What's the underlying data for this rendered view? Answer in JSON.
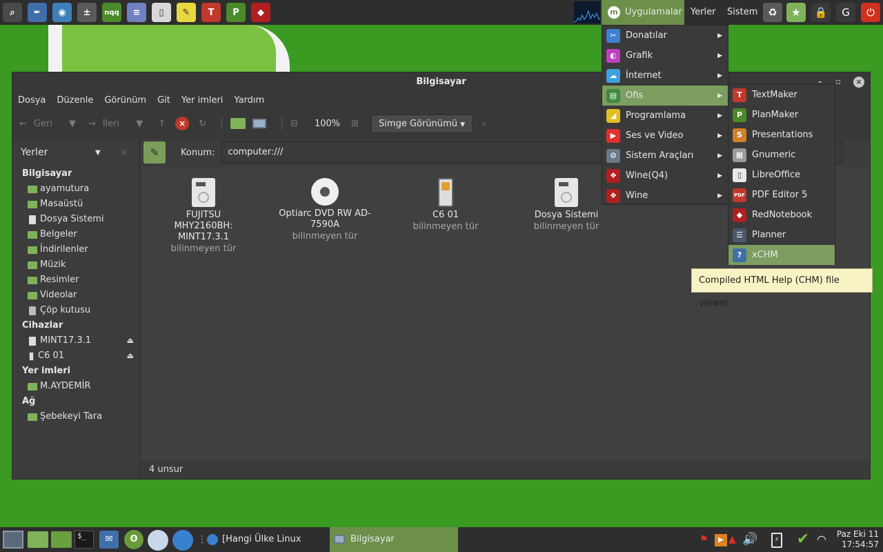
{
  "top_panel": {
    "launchers": [
      {
        "icon": "search-icon",
        "color": "#4a4a4a",
        "glyph": "⌕"
      },
      {
        "icon": "pen-tool-icon",
        "color": "#3f6ea8",
        "glyph": "✒"
      },
      {
        "icon": "camera-icon",
        "color": "#3f7fb8",
        "glyph": "◉"
      },
      {
        "icon": "calculator-icon",
        "color": "#5a5a5a",
        "glyph": "±"
      },
      {
        "icon": "nqq-icon",
        "color": "#4b8a2a",
        "glyph": "nqq"
      },
      {
        "icon": "notes-icon",
        "color": "#7080c0",
        "glyph": "≡"
      },
      {
        "icon": "document-icon",
        "color": "#d8d8d8",
        "glyph": "▯"
      },
      {
        "icon": "sticky-note-icon",
        "color": "#e8d840",
        "glyph": "✎"
      },
      {
        "icon": "textmaker-icon",
        "color": "#c0392b",
        "glyph": "T"
      },
      {
        "icon": "planmaker-icon",
        "color": "#4b8a2a",
        "glyph": "P"
      },
      {
        "icon": "rednotebook-icon",
        "color": "#b02020",
        "glyph": "◆"
      }
    ],
    "apps_label": "Uygulamalar",
    "places_label": "Yerler",
    "system_label": "Sistem",
    "tray": [
      {
        "icon": "trash-icon",
        "color": "#5a5a5a",
        "glyph": "♻"
      },
      {
        "icon": "folder-star-icon",
        "color": "#7fb35a",
        "glyph": "★"
      },
      {
        "icon": "lock-icon",
        "color": "#3a3a3a",
        "glyph": "🔒"
      },
      {
        "icon": "logout-icon",
        "color": "#3a3a3a",
        "glyph": "G"
      },
      {
        "icon": "power-icon",
        "color": "#d03020",
        "glyph": "⏻"
      }
    ]
  },
  "window": {
    "title": "Bilgisayar",
    "menubar": [
      "Dosya",
      "Düzenle",
      "Görünüm",
      "Git",
      "Yer imleri",
      "Yardım"
    ],
    "toolbar": {
      "back_label": "Geri",
      "forward_label": "İleri",
      "zoom": "100%",
      "view_mode": "Simge Görünümü"
    },
    "sidebar": {
      "header": "Yerler",
      "sections": [
        {
          "title": "Bilgisayar",
          "items": [
            {
              "label": "ayamutura",
              "kind": "folder"
            },
            {
              "label": "Masaüstü",
              "kind": "folder"
            },
            {
              "label": "Dosya Sistemi",
              "kind": "drive"
            },
            {
              "label": "Belgeler",
              "kind": "folder"
            },
            {
              "label": "İndirilenler",
              "kind": "folder"
            },
            {
              "label": "Müzik",
              "kind": "folder"
            },
            {
              "label": "Resimler",
              "kind": "folder"
            },
            {
              "label": "Videolar",
              "kind": "folder"
            },
            {
              "label": "Çöp kutusu",
              "kind": "trash"
            }
          ]
        },
        {
          "title": "Cihazlar",
          "items": [
            {
              "label": "MINT17.3.1",
              "kind": "drive",
              "eject": true
            },
            {
              "label": "C6 01",
              "kind": "phone",
              "eject": true
            }
          ]
        },
        {
          "title": "Yer imleri",
          "items": [
            {
              "label": "M.AYDEMİR",
              "kind": "folder"
            }
          ]
        },
        {
          "title": "Ağ",
          "items": [
            {
              "label": "Şebekeyi Tara",
              "kind": "folder"
            }
          ]
        }
      ]
    },
    "location": {
      "label": "Konum:",
      "value": "computer:///"
    },
    "files": [
      {
        "name": "FUJITSU MHY2160BH: MINT17.3.1",
        "type": "bilinmeyen tür",
        "icon": "hard-drive-icon"
      },
      {
        "name": "Optiarc DVD RW AD-7590A",
        "type": "bilinmeyen tür",
        "icon": "optical-drive-icon"
      },
      {
        "name": "C6 01",
        "type": "bilinmeyen tür",
        "icon": "phone-icon"
      },
      {
        "name": "Dosya Sistemi",
        "type": "bilinmeyen tür",
        "icon": "hard-drive-icon"
      }
    ],
    "status": "4 unsur"
  },
  "apps_menu": {
    "items": [
      {
        "label": "Donatılar",
        "icon": "accessories-icon",
        "color": "#3f7fd0",
        "glyph": "✂"
      },
      {
        "label": "Grafik",
        "icon": "graphics-icon",
        "color": "#c040c0",
        "glyph": "◐"
      },
      {
        "label": "İnternet",
        "icon": "internet-icon",
        "color": "#3fa0e0",
        "glyph": "☁"
      },
      {
        "label": "Ofis",
        "icon": "office-icon",
        "color": "#3f8a3f",
        "glyph": "▤",
        "active": true
      },
      {
        "label": "Programlama",
        "icon": "programming-icon",
        "color": "#e0c020",
        "glyph": "◢"
      },
      {
        "label": "Ses ve Video",
        "icon": "multimedia-icon",
        "color": "#e03030",
        "glyph": "▶"
      },
      {
        "label": "Sistem Araçları",
        "icon": "system-tools-icon",
        "color": "#6a7a8a",
        "glyph": "⚙"
      },
      {
        "label": "Wine(Q4)",
        "icon": "wine-icon",
        "color": "#b02020",
        "glyph": "❖"
      },
      {
        "label": "Wine",
        "icon": "wine-icon",
        "color": "#b02020",
        "glyph": "❖"
      }
    ]
  },
  "office_menu": {
    "items": [
      {
        "label": "TextMaker",
        "icon": "textmaker-icon",
        "color": "#c0392b",
        "glyph": "T"
      },
      {
        "label": "PlanMaker",
        "icon": "planmaker-icon",
        "color": "#4b8a2a",
        "glyph": "P"
      },
      {
        "label": "Presentations",
        "icon": "presentations-icon",
        "color": "#d0802a",
        "glyph": "S"
      },
      {
        "label": "Gnumeric",
        "icon": "gnumeric-icon",
        "color": "#9a9a9a",
        "glyph": "▦"
      },
      {
        "label": "LibreOffice",
        "icon": "libreoffice-icon",
        "color": "#e8e8e8",
        "glyph": "▯"
      },
      {
        "label": "PDF Editor 5",
        "icon": "pdf-editor-icon",
        "color": "#c0392b",
        "glyph": "PDF"
      },
      {
        "label": "RedNotebook",
        "icon": "rednotebook-icon",
        "color": "#b02020",
        "glyph": "◆"
      },
      {
        "label": "Planner",
        "icon": "planner-icon",
        "color": "#4a5a6a",
        "glyph": "☰"
      },
      {
        "label": "xCHM",
        "icon": "help-icon",
        "color": "#3f6ea8",
        "glyph": "?",
        "active": true
      }
    ],
    "tooltip": "Compiled HTML Help (CHM) file viewer"
  },
  "bottom_panel": {
    "browser_task": "[Hangi Ülke Linux Dağı...",
    "fm_task": "Bilgisayar",
    "clock_date": "Paz Eki 11",
    "clock_time": "17:54:57"
  }
}
